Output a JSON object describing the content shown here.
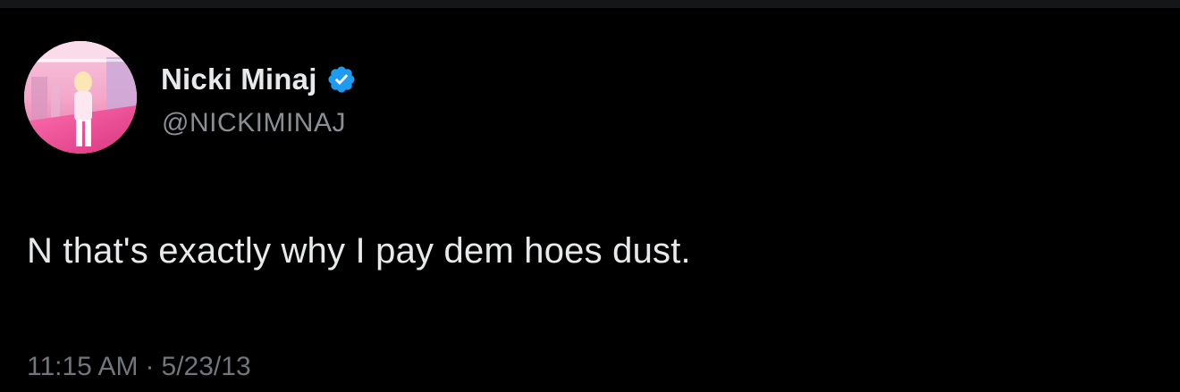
{
  "author": {
    "display_name": "Nicki Minaj",
    "handle": "@NICKIMINAJ",
    "verified": true,
    "verified_color": "#1d9bf0",
    "avatar_icon": "profile-photo-pink-avatar"
  },
  "tweet": {
    "text": "N that's exactly why I pay dem hoes dust.",
    "time": "11:15 AM",
    "separator": "·",
    "date": "5/23/13"
  },
  "theme": {
    "background": "#000000",
    "primary_text": "#e7e9ea",
    "secondary_text": "#71767b"
  }
}
